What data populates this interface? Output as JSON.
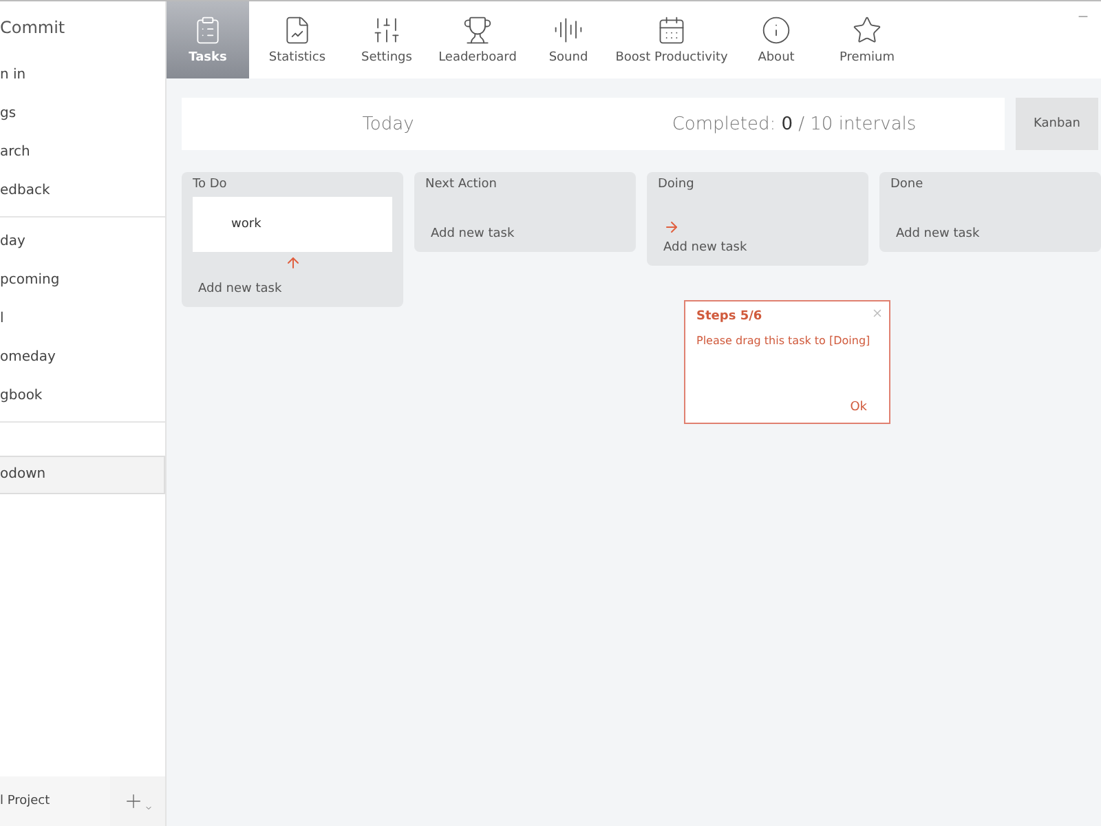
{
  "app_title": "Commit",
  "sidebar": {
    "top_items": [
      {
        "label": "n in",
        "selected": false
      },
      {
        "label": "gs",
        "selected": false
      },
      {
        "label": "arch",
        "selected": false
      },
      {
        "label": "edback",
        "selected": false
      }
    ],
    "list_items": [
      {
        "label": "day",
        "selected": false
      },
      {
        "label": "pcoming",
        "selected": false
      },
      {
        "label": "l",
        "selected": false
      },
      {
        "label": "omeday",
        "selected": false
      },
      {
        "label": "gbook",
        "selected": false
      }
    ],
    "projects": [
      {
        "label": "odown",
        "selected": true
      }
    ],
    "footer": {
      "label": "l Project"
    }
  },
  "nav_tabs": [
    {
      "label": "Tasks",
      "selected": true
    },
    {
      "label": "Statistics",
      "selected": false
    },
    {
      "label": "Settings",
      "selected": false
    },
    {
      "label": "Leaderboard",
      "selected": false
    },
    {
      "label": "Sound",
      "selected": false
    },
    {
      "label": "Boost Productivity",
      "selected": false
    },
    {
      "label": "About",
      "selected": false
    },
    {
      "label": "Premium",
      "selected": false
    }
  ],
  "summary": {
    "day": "Today",
    "completed": "Completed: **0** / 10 intervals"
  },
  "view_button": {
    "label": "Kanban"
  },
  "columns": [
    {
      "title": "To Do",
      "kind": "source",
      "tasks": [
        "work"
      ],
      "add_label": "Add new task"
    },
    {
      "title": "Next Action",
      "kind": "plain",
      "add_label": "Add new task"
    },
    {
      "title": "Doing",
      "kind": "target",
      "add_label": "Add new task"
    },
    {
      "title": "Done",
      "kind": "plain",
      "add_label": "Add new task"
    }
  ],
  "tour_popup": {
    "title": "Steps 5/6",
    "message": "Please drag this task to [Doing]",
    "ok": "Ok"
  }
}
